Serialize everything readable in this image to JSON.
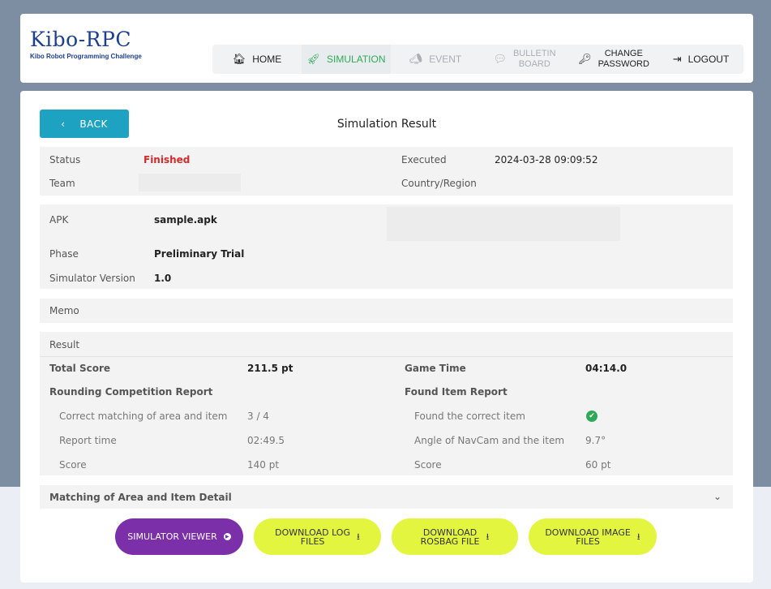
{
  "logo": {
    "title": "Kibo-RPC",
    "subtitle": "Kibo Robot Programming Challenge"
  },
  "nav": {
    "home": "HOME",
    "simulation": "SIMULATION",
    "event": "EVENT",
    "bulletin_1": "BULLETIN",
    "bulletin_2": "BOARD",
    "change_1": "CHANGE",
    "change_2": "PASSWORD",
    "logout": "LOGOUT"
  },
  "back_label": "BACK",
  "back_icon": "‹",
  "page_title": "Simulation Result",
  "info": {
    "status_label": "Status",
    "status_value": "Finished",
    "executed_label": "Executed",
    "executed_value": "2024-03-28 09:09:52",
    "team_label": "Team",
    "country_label": "Country/Region"
  },
  "apk": {
    "apk_label": "APK",
    "apk_value": "sample.apk",
    "phase_label": "Phase",
    "phase_value": "Preliminary Trial",
    "simver_label": "Simulator Version",
    "simver_value": "1.0"
  },
  "memo_label": "Memo",
  "result": {
    "title": "Result",
    "total_label": "Total Score",
    "total_value": "211.5 pt",
    "game_label": "Game Time",
    "game_value": "04:14.0",
    "rounding_title": "Rounding Competition Report",
    "found_title": "Found Item Report",
    "rounding": [
      {
        "label": "Correct matching of area and item",
        "value": "3 / 4"
      },
      {
        "label": "Report time",
        "value": "02:49.5"
      },
      {
        "label": "Score",
        "value": "140 pt"
      }
    ],
    "found": [
      {
        "label": "Found the correct item",
        "value": ""
      },
      {
        "label": "Angle of NavCam and the item",
        "value": "9.7°"
      },
      {
        "label": "Score",
        "value": "60 pt"
      }
    ]
  },
  "matching_label": "Matching of Area and Item Detail",
  "buttons": {
    "viewer": "SIMULATOR VIEWER",
    "log_1": "DOWNLOAD LOG",
    "log_2": "FILES",
    "rosbag_1": "DOWNLOAD",
    "rosbag_2": "ROSBAG FILE",
    "image_1": "DOWNLOAD IMAGE",
    "image_2": "FILES"
  }
}
